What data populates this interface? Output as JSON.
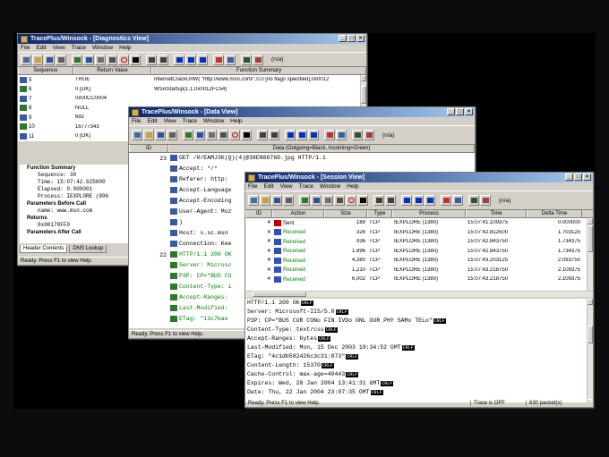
{
  "colors": {
    "title_start": "#0a246a",
    "title_end": "#a6caf0",
    "received": "#008000",
    "sent": "#c00000",
    "stop": "#d00000"
  },
  "menu": [
    "File",
    "Edit",
    "View",
    "Trace",
    "Window",
    "Help"
  ],
  "na_label": "(n/a)",
  "diag": {
    "title": "TracePlus/Winsock - [Diagnostics View]",
    "columns": [
      "Sequence",
      "Return Value",
      "Function Summary"
    ],
    "rows": [
      {
        "seq": "5",
        "ret": "TRUE",
        "fn": "InternetCrackUrlW(  \"http://www.msn.com/\",0,0 [no flags specified],0x0012"
      },
      {
        "seq": "6",
        "ret": "0 [OK]",
        "fn": "WSAStartup(1.1,0x0012FC54)"
      },
      {
        "seq": "7",
        "ret": "0x00CC0004",
        "fn": ""
      },
      {
        "seq": "8",
        "ret": "NULL",
        "fn": ""
      },
      {
        "seq": "9",
        "ret": "692",
        "fn": ""
      },
      {
        "seq": "10",
        "ret": "16777343",
        "fn": ""
      },
      {
        "seq": "11",
        "ret": "0 [OK]",
        "fn": ""
      }
    ],
    "tree": [
      "Function Summary",
      "Sequence: 30",
      "Time: 15:07:42.625000",
      "Elapsed: 0.000001",
      "Process: IEXPLORE (896",
      "Parameters Before Call",
      "name: www.msn.com",
      "Returns",
      "0x00178FF0",
      "Parameters After Call"
    ],
    "tabs": [
      "Header Contents",
      "DNS Lookup"
    ],
    "status": "Ready.  Press F1 to view Help."
  },
  "data": {
    "title": "TracePlus/Winsock - [Data View]",
    "columns": [
      "ID",
      "Data (Outgoing=Black, Incoming=Green)"
    ],
    "lines": [
      {
        "id": "23",
        "text": "GET /0/EAMJ3K(Q)(4)@38EN8876D.jpg HTTP/1.1",
        "incoming": false
      },
      {
        "id": "",
        "text": "Accept: */*",
        "incoming": false
      },
      {
        "id": "",
        "text": "Referer: http:",
        "incoming": false
      },
      {
        "id": "",
        "text": "Accept-Language",
        "incoming": false
      },
      {
        "id": "",
        "text": "Accept-Encoding",
        "incoming": false
      },
      {
        "id": "",
        "text": "User-Agent: Moz",
        "incoming": false
      },
      {
        "id": "",
        "text": ")",
        "incoming": false
      },
      {
        "id": "",
        "text": "Host: s.sc.msn",
        "incoming": false
      },
      {
        "id": "",
        "text": "Connection: Kee",
        "incoming": false
      },
      {
        "id": "22",
        "text": "HTTP/1.1 200 OK",
        "incoming": true
      },
      {
        "id": "",
        "text": "Server: Microsc",
        "incoming": true
      },
      {
        "id": "",
        "text": "P3P: CP=\"BUS CU",
        "incoming": true
      },
      {
        "id": "",
        "text": "Content-Type: i",
        "incoming": true
      },
      {
        "id": "",
        "text": "Accept-Ranges:",
        "incoming": true
      },
      {
        "id": "",
        "text": "Last-Modified:",
        "incoming": true
      },
      {
        "id": "",
        "text": "ETag: \"13c7bae",
        "incoming": true
      }
    ],
    "status": "Ready.  Press F1 to view Help."
  },
  "session": {
    "title": "TracePlus/Winsock - [Session View]",
    "columns": [
      "ID",
      "Action",
      "Size",
      "Type",
      "Process",
      "Time",
      "Delta Time"
    ],
    "rows": [
      {
        "id": "4",
        "action": "Sent",
        "size": "189",
        "type": "TCP",
        "process": "IEXPLORE (1380)",
        "time": "15:07:41.109375",
        "delta": "0.000000"
      },
      {
        "id": "4",
        "action": "Received",
        "size": "326",
        "type": "TCP",
        "process": "IEXPLORE (1380)",
        "time": "15:07:42.812500",
        "delta": "1.703125"
      },
      {
        "id": "4",
        "action": "Received",
        "size": "936",
        "type": "TCP",
        "process": "IEXPLORE (1380)",
        "time": "15:07:42.843750",
        "delta": "1.734375"
      },
      {
        "id": "4",
        "action": "Received",
        "size": "1,896",
        "type": "TCP",
        "process": "IEXPLORE (1380)",
        "time": "15:07:42.843750",
        "delta": "1.734375"
      },
      {
        "id": "4",
        "action": "Received",
        "size": "4,380",
        "type": "TCP",
        "process": "IEXPLORE (1380)",
        "time": "15:07:43.203125",
        "delta": "2.093750"
      },
      {
        "id": "4",
        "action": "Received",
        "size": "1,210",
        "type": "TCP",
        "process": "IEXPLORE (1380)",
        "time": "15:07:43.218750",
        "delta": "2.109375"
      },
      {
        "id": "4",
        "action": "Received",
        "size": "6,002",
        "type": "TCP",
        "process": "IEXPLORE (1380)",
        "time": "15:07:43.218750",
        "delta": "2.109375"
      }
    ],
    "crlf_label": "CRLF",
    "detail": [
      "HTTP/1.1 200 OK",
      "Server: Microsoft-IIS/5.0",
      "P3P: CP=\"BUS CUR CONo FIN IVDo ONL OUR PHY SAMo TELo\"",
      "Content-Type: text/css",
      "Accept-Ranges: bytes",
      "Last-Modified: Mon, 15 Dec 2003 19:34:52 GMT",
      "ETag: \"4c1db582426c3c31:873\"",
      "Content-Length: 15370",
      "Cache-Control: max-age=40443",
      "Expires: Wed, 28 Jan 2004 13:41:31 GMT",
      "Date: Thu, 22 Jan 2004 23:07:35 GMT"
    ],
    "status": "Ready.  Press F1 to view Help.",
    "trace_state": "Trace is OFF",
    "packets": "630 packet(s)"
  }
}
